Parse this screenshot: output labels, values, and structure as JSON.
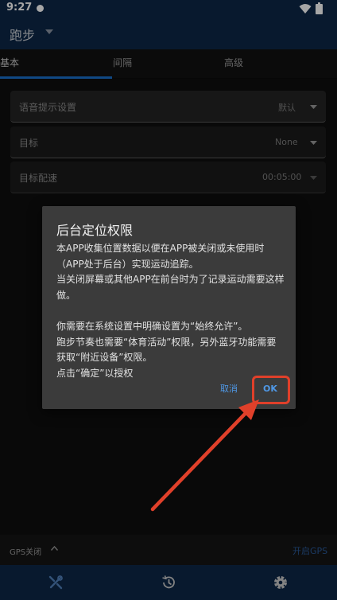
{
  "status_bar": {
    "time": "9:27"
  },
  "app_bar": {
    "title": "跑步"
  },
  "tabs": [
    {
      "label": "基本",
      "selected": true
    },
    {
      "label": "间隔",
      "selected": false
    },
    {
      "label": "高级",
      "selected": false
    }
  ],
  "fields": {
    "voice": {
      "label": "语音提示设置",
      "value": "默认"
    },
    "goal": {
      "label": "目标",
      "value": "None"
    },
    "pace": {
      "label": "目标配速",
      "value": "00:05:00"
    }
  },
  "dialog": {
    "title": "后台定位权限",
    "message": "本APP收集位置数据以便在APP被关闭或未使用时（APP处于后台）实现运动追踪。\n当关闭屏幕或其他APP在前台时为了记录运动需要这样做。\n\n你需要在系统设置中明确设置为“始终允许”。\n跑步节奏也需要“体育活动”权限，另外蓝牙功能需要获取“附近设备”权限。\n点击“确定”以授权",
    "cancel_label": "取消",
    "ok_label": "OK"
  },
  "gps_bar": {
    "status": "GPS关闭",
    "open_label": "开启GPS"
  },
  "bottom_nav": [
    {
      "icon": "tools-icon",
      "selected": true
    },
    {
      "icon": "history-icon",
      "selected": false
    },
    {
      "icon": "settings-icon",
      "selected": false
    }
  ],
  "colors": {
    "primary_dark": "#0d2747",
    "accent": "#1a6fc9",
    "dialog_button": "#4f98e6",
    "annotation": "#e0402a"
  }
}
